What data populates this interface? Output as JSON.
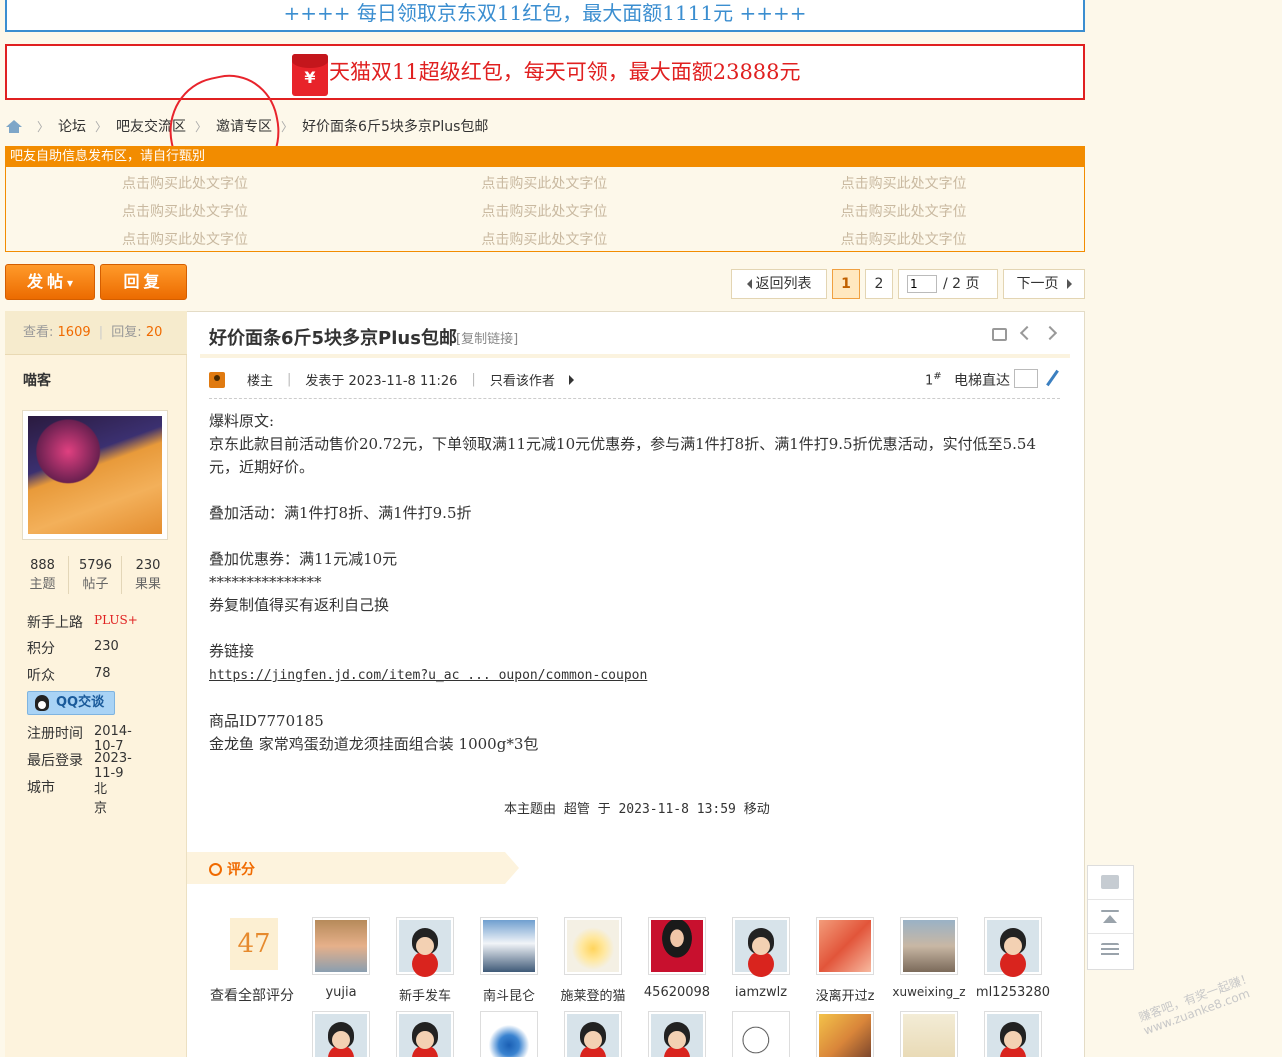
{
  "banners": {
    "jd": "++++ 每日领取京东双11红包，最大面额1111元 ++++",
    "tmall_icon": "¥",
    "tmall": "天猫双11超级红包，每天可领，最大面额23888元"
  },
  "breadcrumb": [
    "论坛",
    "吧友交流区",
    "邀请专区",
    "好价面条6斤5块多京Plus包邮"
  ],
  "adbox": {
    "header": "吧友自助信息发布区，请自行甄别",
    "slots": [
      [
        "点击购买此处文字位",
        "点击购买此处文字位",
        "点击购买此处文字位"
      ],
      [
        "点击购买此处文字位",
        "点击购买此处文字位",
        "点击购买此处文字位"
      ],
      [
        "点击购买此处文字位",
        "点击购买此处文字位",
        "点击购买此处文字位"
      ]
    ]
  },
  "toolbar": {
    "post": "发帖",
    "post_arrow": "▾",
    "reply": "回复"
  },
  "pagination": {
    "back": "返回列表",
    "page1": "1",
    "page2": "2",
    "input_value": "1",
    "total": "/ 2 页",
    "next": "下一页"
  },
  "stats": {
    "views_label": "查看:",
    "views": "1609",
    "replies_label": "回复:",
    "replies": "20"
  },
  "author": {
    "name": "喵客",
    "counts": [
      {
        "value": "888",
        "label": "主题"
      },
      {
        "value": "5796",
        "label": "帖子"
      },
      {
        "value": "230",
        "label": "果果"
      }
    ],
    "rank_label": "新手上路",
    "rank_badge": "PLUS+",
    "points_label": "积分",
    "points": "230",
    "fans_label": "听众",
    "fans": "78",
    "qq": "QQ交谈",
    "reg_label": "注册时间",
    "reg": "2014-10-7",
    "last_label": "最后登录",
    "last": "2023-11-9",
    "city_label": "城市",
    "city": "北京"
  },
  "post": {
    "title": "好价面条6斤5块多京Plus包邮",
    "copy_link": "[复制链接]",
    "role": "楼主",
    "posted": "发表于 2023-11-8 11:26",
    "only_author": "只看该作者",
    "floor": "1",
    "floor_suffix": "#",
    "elevator": "电梯直达",
    "body": [
      "爆料原文:",
      "京东此款目前活动售价20.72元，下单领取满11元减10元优惠券，参与满1件打8折、满1件打9.5折优惠活动，实付低至5.54元，近期好价。",
      "",
      "叠加活动：满1件打8折、满1件打9.5折",
      "",
      "叠加优惠券：满11元减10元",
      "***************",
      "券复制值得买有返利自己换",
      "",
      "券链接"
    ],
    "link": "https://jingfen.jd.com/item?u_ac ... oupon/common-coupon",
    "body2": [
      "",
      "商品ID7770185",
      "金龙鱼 家常鸡蛋劲道龙须挂面组合装 1000g*3包"
    ],
    "moved": "本主题由 超管 于 2023-11-8 13:59 移动"
  },
  "rating": {
    "title": "评分",
    "count": "47",
    "view_all": "查看全部评分",
    "raters": [
      "yujia",
      "新手发车",
      "南斗昆仑",
      "施莱登的猫",
      "45620098",
      "iamzwlz",
      "没离开过z",
      "xuweixing_z",
      "ml1253280"
    ]
  },
  "watermark": [
    "赚客吧，有奖一起赚！",
    "www.zuanke8.com"
  ]
}
